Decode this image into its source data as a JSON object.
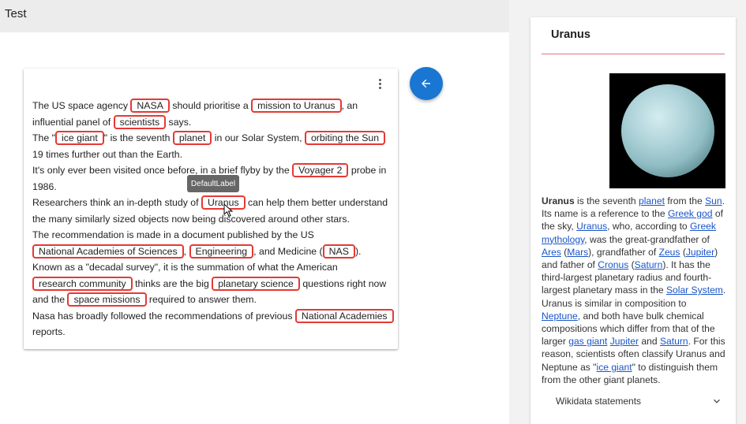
{
  "app": {
    "title": "Test"
  },
  "tooltip": {
    "text": "DefaultLabel"
  },
  "document": {
    "paragraphs": [
      [
        {
          "t": "The US space agency "
        },
        {
          "e": "NASA"
        },
        {
          "t": " should prioritise a "
        },
        {
          "e": "mission to Uranus"
        },
        {
          "t": ", an influential panel of "
        },
        {
          "e": "scientists"
        },
        {
          "t": " says."
        }
      ],
      [
        {
          "t": "The \""
        },
        {
          "e": "ice giant"
        },
        {
          "t": "\" is the seventh "
        },
        {
          "e": "planet"
        },
        {
          "t": " in our Solar System, "
        },
        {
          "e": "orbiting the Sun"
        },
        {
          "t": " 19 times further out than the Earth."
        }
      ],
      [
        {
          "t": "It's only ever been visited once before, in a brief flyby by the "
        },
        {
          "e": "Voyager 2"
        },
        {
          "t": " probe in 1986."
        }
      ],
      [
        {
          "t": "Researchers think an in-depth study of "
        },
        {
          "e": "Uranus"
        },
        {
          "t": " can help them better understand the many similarly sized objects now being discovered around other stars."
        }
      ],
      [
        {
          "t": "The recommendation is made in a document published by the US "
        },
        {
          "e": "National Academies of Sciences"
        },
        {
          "t": ", "
        },
        {
          "e": "Engineering"
        },
        {
          "t": ", and Medicine ("
        },
        {
          "e": "NAS"
        },
        {
          "t": ")."
        }
      ],
      [
        {
          "t": "Known as a \"decadal survey\", it is the summation of what the American "
        },
        {
          "e": "research community"
        },
        {
          "t": " thinks are the big "
        },
        {
          "e": "planetary science"
        },
        {
          "t": " questions right now and the "
        },
        {
          "e": "space missions"
        },
        {
          "t": " required to answer them."
        }
      ],
      [
        {
          "t": "Nasa has broadly followed the recommendations of previous "
        },
        {
          "e": "National Academies"
        },
        {
          "t": " reports."
        }
      ]
    ]
  },
  "panel": {
    "title": "Uranus",
    "description": [
      {
        "b": "Uranus"
      },
      {
        "t": " is the seventh "
      },
      {
        "a": "planet"
      },
      {
        "t": " from the "
      },
      {
        "a": "Sun"
      },
      {
        "t": ". Its name is a reference to the "
      },
      {
        "a": "Greek god"
      },
      {
        "t": " of the sky, "
      },
      {
        "a": "Uranus"
      },
      {
        "t": ", who, according to "
      },
      {
        "a": "Greek mythology"
      },
      {
        "t": ", was the great-grandfather of "
      },
      {
        "a": "Ares"
      },
      {
        "t": " ("
      },
      {
        "a": "Mars"
      },
      {
        "t": "), grandfather of "
      },
      {
        "a": "Zeus"
      },
      {
        "t": " ("
      },
      {
        "a": "Jupiter"
      },
      {
        "t": ") and father of "
      },
      {
        "a": "Cronus"
      },
      {
        "t": " ("
      },
      {
        "a": "Saturn"
      },
      {
        "t": "). It has the third-largest planetary radius and fourth-largest planetary mass in the "
      },
      {
        "a": "Solar System"
      },
      {
        "t": ". Uranus is similar in composition to "
      },
      {
        "a": "Neptune"
      },
      {
        "t": ", and both have bulk chemical compositions which differ from that of the larger "
      },
      {
        "a": "gas giant"
      },
      {
        "t": " "
      },
      {
        "a": "Jupiter"
      },
      {
        "t": " and "
      },
      {
        "a": "Saturn"
      },
      {
        "t": ". For this reason, scientists often classify Uranus and Neptune as \""
      },
      {
        "a": "ice giant"
      },
      {
        "t": "\" to distinguish them from the other giant planets."
      }
    ],
    "wikidata_label": "Wikidata statements"
  },
  "colors": {
    "entity_border": "#e53935",
    "fab": "#1976d2",
    "link": "#1a55c9",
    "panel_divider": "#e57373"
  },
  "icons": {
    "fab": "arrow-left-icon",
    "menu": "more-vert-icon",
    "expand": "chevron-down-icon",
    "cursor": "mouse-pointer-icon"
  }
}
